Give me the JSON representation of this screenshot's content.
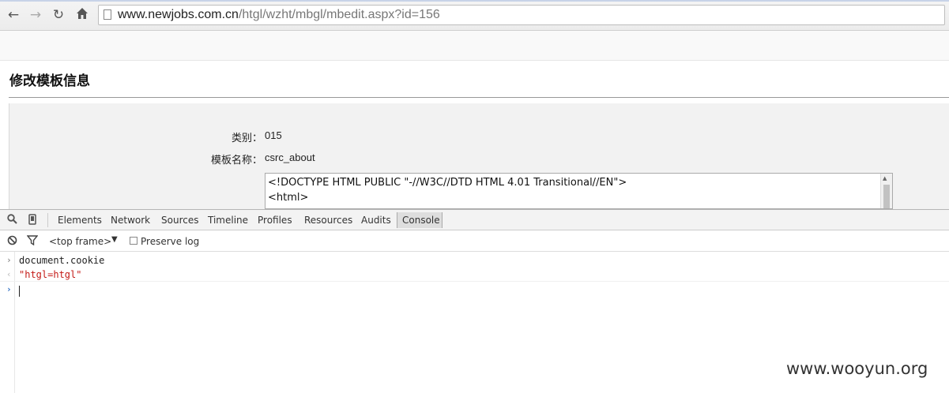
{
  "browser": {
    "url_host": "www.newjobs.com.cn",
    "url_path": "/htgl/wzht/mbgl/mbedit.aspx?id=156",
    "icons": [
      "back-icon",
      "forward-icon",
      "reload-icon",
      "home-icon",
      "page-icon"
    ]
  },
  "page": {
    "title": "修改模板信息",
    "fields": [
      {
        "label": "类别：",
        "value": "015"
      },
      {
        "label": "模板名称：",
        "value": "csrc_about"
      }
    ],
    "template_lines": [
      "<!DOCTYPE HTML PUBLIC \"-//W3C//DTD HTML 4.01 Transitional//EN\">",
      "<html>"
    ]
  },
  "devtools": {
    "tabs": [
      "Elements",
      "Network",
      "Sources",
      "Timeline",
      "Profiles",
      "Resources",
      "Audits",
      "Console"
    ],
    "active_tab": "Console",
    "frame_selector": "<top frame>",
    "preserve_log_label": "Preserve log",
    "console": {
      "input": "document.cookie",
      "output": "\"htgl=htgl\""
    },
    "colors": {
      "output": "#c41a16",
      "prompt": "#2f6ec4"
    }
  },
  "watermark": "www.wooyun.org"
}
